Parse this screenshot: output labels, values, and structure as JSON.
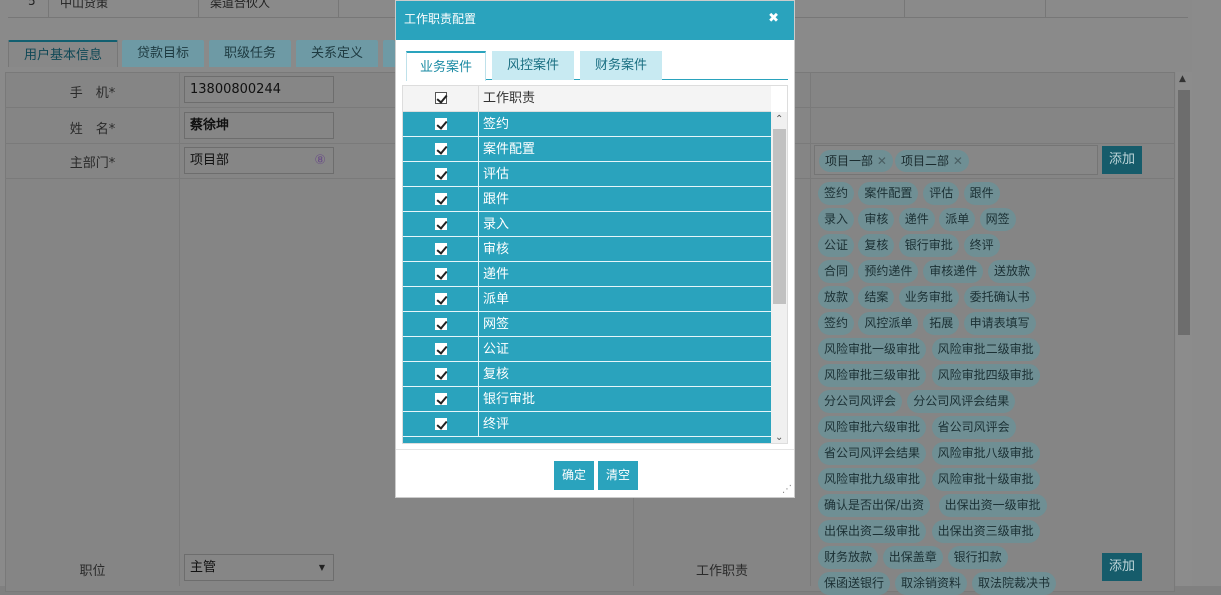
{
  "top_row": {
    "index": "5",
    "name": "中山贷策",
    "role": "渠道合伙人"
  },
  "tabs": [
    "用户基本信息",
    "贷款目标",
    "职级任务",
    "关系定义"
  ],
  "form": {
    "phone_label": "手　机*",
    "phone_value": "13800800244",
    "name_label": "姓　名*",
    "name_value": "蔡徐坤",
    "dept_label": "主部门*",
    "dept_value": "项目部",
    "dept_icon_glyph": "⑧",
    "position_label": "职位",
    "position_value": "主管",
    "duty_label": "工作职责",
    "dept_chips": [
      "项目一部",
      "项目二部"
    ],
    "add_label": "添加",
    "duty_pills": [
      "签约",
      "案件配置",
      "评估",
      "跟件",
      "录入",
      "审核",
      "递件",
      "派单",
      "网签",
      "公证",
      "复核",
      "银行审批",
      "终评",
      "合同",
      "预约递件",
      "审核递件",
      "送放款",
      "放款",
      "结案",
      "业务审批",
      "委托确认书",
      "签约",
      "风控派单",
      "拓展",
      "申请表填写",
      "风险审批一级审批",
      "风险审批二级审批",
      "风险审批三级审批",
      "风险审批四级审批",
      "分公司风评会",
      "分公司风评会结果",
      "风险审批六级审批",
      "省公司风评会",
      "省公司风评会结果",
      "风险审批八级审批",
      "风险审批九级审批",
      "风险审批十级审批",
      "确认是否出保/出资",
      "出保出资一级审批",
      "出保出资二级审批",
      "出保出资三级审批",
      "财务放款",
      "出保盖章",
      "银行扣款",
      "保函送银行",
      "取涂销资料",
      "取法院裁决书"
    ]
  },
  "modal": {
    "title": "工作职责配置",
    "close_glyph": "✖",
    "tabs": [
      "业务案件",
      "风控案件",
      "财务案件"
    ],
    "header": "工作职责",
    "rows": [
      "签约",
      "案件配置",
      "评估",
      "跟件",
      "录入",
      "审核",
      "递件",
      "派单",
      "网签",
      "公证",
      "复核",
      "银行审批",
      "终评"
    ],
    "confirm_label": "确定",
    "clear_label": "清空"
  },
  "colors": {
    "accent": "#2aa3bd",
    "overlay": "#808080"
  }
}
